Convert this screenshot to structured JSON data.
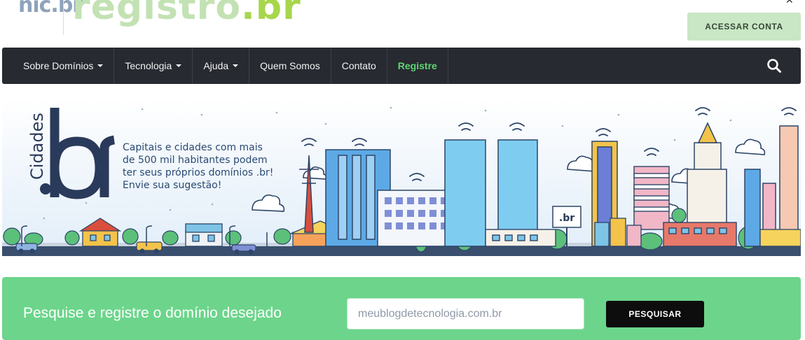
{
  "header": {
    "logo_nic": "nic.br",
    "logo_registro": "registro",
    "logo_registro_suffix": ".br",
    "account_button": "ACESSAR CONTA"
  },
  "nav": {
    "items": [
      {
        "label": "Sobre Domínios"
      },
      {
        "label": "Tecnologia"
      },
      {
        "label": "Ajuda"
      },
      {
        "label": "Quem Somos"
      },
      {
        "label": "Contato"
      },
      {
        "label": "Registre"
      }
    ],
    "search_icon": "search-icon"
  },
  "banner": {
    "vertical_word": "Cidades",
    "big_mark": ".br",
    "text": "Capitais e cidades com mais de 500 mil habitantes podem ter seus próprios domínios .br! Envie sua sugestão!",
    "sign_text": ".br"
  },
  "search": {
    "label": "Pesquise e registre o domínio desejado",
    "input_value": "meublogdetecnologia.com.br",
    "button": "PESQUISAR"
  },
  "colors": {
    "nav_bg": "#272a30",
    "registre_green": "#5fd574",
    "search_bg": "#6cd58b",
    "account_btn_bg": "#c9e7c4"
  }
}
